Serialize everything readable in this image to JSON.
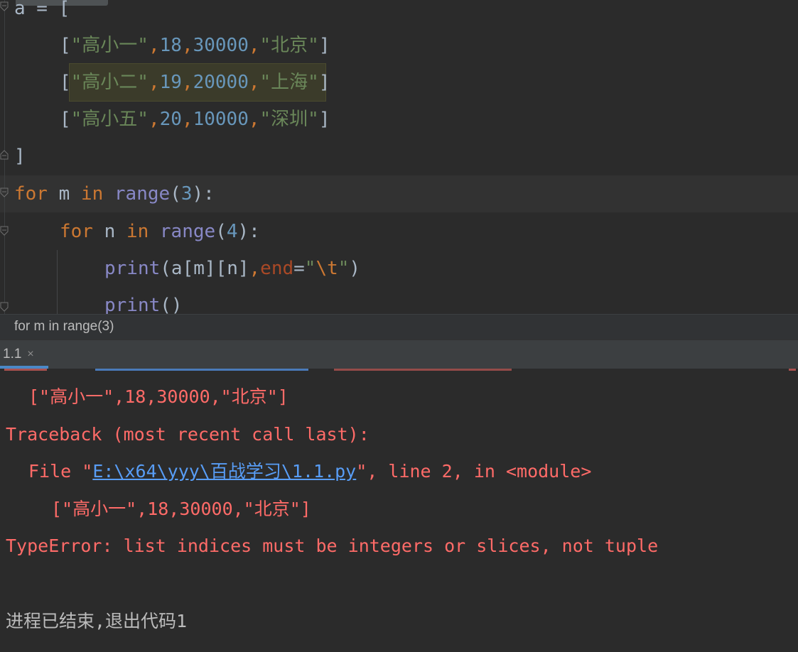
{
  "editor": {
    "lines": [
      {
        "id": "l0",
        "segments": [
          {
            "t": "a = [",
            "c": "plain"
          }
        ]
      },
      {
        "id": "l1",
        "segments": [
          {
            "t": "[",
            "c": "plain"
          },
          {
            "t": "\"高小一\"",
            "c": "str"
          },
          {
            "t": ",",
            "c": "kw"
          },
          {
            "t": "18",
            "c": "num"
          },
          {
            "t": ",",
            "c": "kw"
          },
          {
            "t": "30000",
            "c": "num"
          },
          {
            "t": ",",
            "c": "kw"
          },
          {
            "t": "\"北京\"",
            "c": "str"
          },
          {
            "t": "]",
            "c": "plain"
          }
        ]
      },
      {
        "id": "l2",
        "segments": [
          {
            "t": "[",
            "c": "plain"
          },
          {
            "t": "\"高小二\"",
            "c": "str"
          },
          {
            "t": ",",
            "c": "kw"
          },
          {
            "t": "19",
            "c": "num"
          },
          {
            "t": ",",
            "c": "kw"
          },
          {
            "t": "20000",
            "c": "num"
          },
          {
            "t": ",",
            "c": "kw"
          },
          {
            "t": "\"上海\"",
            "c": "str"
          },
          {
            "t": "]",
            "c": "plain"
          }
        ]
      },
      {
        "id": "l3",
        "segments": [
          {
            "t": "[",
            "c": "plain"
          },
          {
            "t": "\"高小五\"",
            "c": "str"
          },
          {
            "t": ",",
            "c": "kw"
          },
          {
            "t": "20",
            "c": "num"
          },
          {
            "t": ",",
            "c": "kw"
          },
          {
            "t": "10000",
            "c": "num"
          },
          {
            "t": ",",
            "c": "kw"
          },
          {
            "t": "\"深圳\"",
            "c": "str"
          },
          {
            "t": "]",
            "c": "plain"
          }
        ]
      },
      {
        "id": "l4",
        "segments": [
          {
            "t": "]",
            "c": "plain"
          }
        ]
      },
      {
        "id": "l5",
        "segments": [
          {
            "t": "for",
            "c": "kw"
          },
          {
            "t": " m ",
            "c": "plain"
          },
          {
            "t": "in",
            "c": "kw"
          },
          {
            "t": " ",
            "c": "plain"
          },
          {
            "t": "range",
            "c": "bi"
          },
          {
            "t": "(",
            "c": "plain"
          },
          {
            "t": "3",
            "c": "num"
          },
          {
            "t": "):",
            "c": "plain"
          }
        ]
      },
      {
        "id": "l6",
        "segments": [
          {
            "t": "for",
            "c": "kw"
          },
          {
            "t": " n ",
            "c": "plain"
          },
          {
            "t": "in",
            "c": "kw"
          },
          {
            "t": " ",
            "c": "plain"
          },
          {
            "t": "range",
            "c": "bi"
          },
          {
            "t": "(",
            "c": "plain"
          },
          {
            "t": "4",
            "c": "num"
          },
          {
            "t": "):",
            "c": "plain"
          }
        ]
      },
      {
        "id": "l7",
        "segments": [
          {
            "t": "print",
            "c": "bi"
          },
          {
            "t": "(a[m][n]",
            "c": "plain"
          },
          {
            "t": ",",
            "c": "kw"
          },
          {
            "t": "end",
            "c": "param"
          },
          {
            "t": "=",
            "c": "plain"
          },
          {
            "t": "\"",
            "c": "str"
          },
          {
            "t": "\\t",
            "c": "esc"
          },
          {
            "t": "\"",
            "c": "str"
          },
          {
            "t": ")",
            "c": "plain"
          }
        ]
      },
      {
        "id": "l8",
        "segments": [
          {
            "t": "print",
            "c": "bi"
          },
          {
            "t": "()",
            "c": "plain"
          }
        ]
      }
    ]
  },
  "breadcrumb": {
    "text": "for m in range(3)"
  },
  "run_panel": {
    "tab_label": "1.1",
    "tab_close": "×"
  },
  "console": {
    "echo_line": "[\"高小一\",18,30000,\"北京\"]",
    "traceback_header": "Traceback (most recent call last):",
    "file_prefix": "File \"",
    "file_link": "E:\\x64\\yyy\\百战学习\\1.1.py",
    "file_suffix": "\", line 2, in <module>",
    "source_line": "[\"高小一\",18,30000,\"北京\"]",
    "error_line": "TypeError: list indices must be integers or slices, not tuple",
    "exit_line": "进程已结束,退出代码1"
  },
  "colors": {
    "background": "#2b2b2b",
    "keyword": "#cc7832",
    "string": "#6a8759",
    "number": "#6897bb",
    "builtin": "#8888c6",
    "error": "#ff6b68",
    "link": "#589df6"
  }
}
